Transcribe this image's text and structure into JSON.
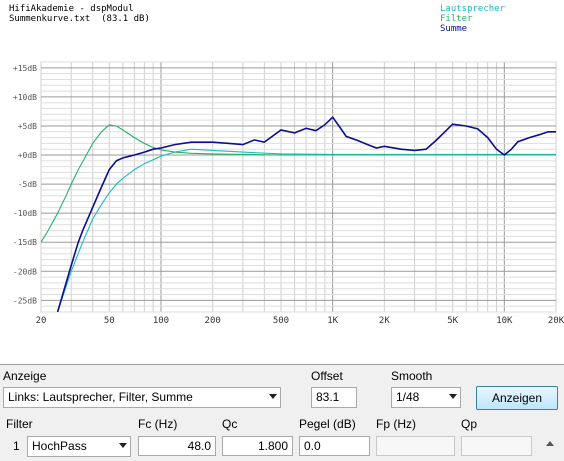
{
  "plot": {
    "header_line1": "HifiAkademie - dspModul",
    "header_line2": "Summenkurve.txt  (83.1 dB)",
    "legend": [
      {
        "label": "Lautsprecher",
        "color": "#19bcc1"
      },
      {
        "label": "Filter",
        "color": "#21b36a"
      },
      {
        "label": "Summe",
        "color": "#0b0f8f"
      }
    ],
    "y_ticks": [
      "+15dB",
      "+10dB",
      "+5dB",
      "+0dB",
      "-5dB",
      "-10dB",
      "-15dB",
      "-20dB",
      "-25dB"
    ],
    "x_ticks": [
      "20",
      "50",
      "100",
      "200",
      "500",
      "1K",
      "2K",
      "5K",
      "10K",
      "20K"
    ]
  },
  "chart_data": {
    "type": "line",
    "title": "Summenkurve.txt  (83.1 dB)",
    "x_scale": "log",
    "xlim": [
      20,
      20000
    ],
    "ylim": [
      -27,
      16
    ],
    "grid": true,
    "legend_position": "top-right",
    "series": [
      {
        "name": "Lautsprecher",
        "color": "#19bcc1",
        "x": [
          25,
          30,
          35,
          40,
          45,
          50,
          55,
          60,
          70,
          80,
          100,
          120,
          150,
          200,
          300,
          500,
          1000,
          2000,
          5000,
          10000,
          20000
        ],
        "y": [
          -27,
          -20,
          -15,
          -11,
          -8.5,
          -6.5,
          -5,
          -4,
          -2.5,
          -1.5,
          -0.2,
          0.5,
          1,
          0.8,
          0.5,
          0.2,
          0.1,
          0.1,
          0.1,
          0.1,
          0.1
        ]
      },
      {
        "name": "Filter",
        "color": "#21b36a",
        "x": [
          20,
          22,
          25,
          28,
          30,
          33,
          36,
          40,
          45,
          50,
          55,
          60,
          70,
          80,
          90,
          100,
          120,
          150,
          200,
          300,
          500,
          1000,
          2000,
          5000,
          10000,
          20000
        ],
        "y": [
          -15,
          -13,
          -10,
          -7,
          -5,
          -2.5,
          -0.5,
          2,
          4,
          5.2,
          5,
          4.3,
          3,
          2,
          1.3,
          0.9,
          0.5,
          0.3,
          0.2,
          0.1,
          0,
          0,
          0,
          0,
          0,
          0
        ]
      },
      {
        "name": "Summe",
        "color": "#0b0f8f",
        "x": [
          25,
          28,
          30,
          33,
          35,
          40,
          45,
          50,
          55,
          60,
          70,
          80,
          90,
          100,
          120,
          150,
          200,
          250,
          300,
          350,
          400,
          500,
          600,
          700,
          800,
          900,
          1000,
          1100,
          1200,
          1400,
          1600,
          1800,
          2000,
          2500,
          3000,
          3500,
          4000,
          5000,
          6000,
          7000,
          8000,
          9000,
          10000,
          11000,
          12000,
          14000,
          16000,
          18000,
          20000
        ],
        "y": [
          -27,
          -22,
          -19,
          -15,
          -13,
          -9,
          -5.5,
          -2.5,
          -1,
          -0.5,
          0,
          0.5,
          1,
          1.2,
          1.8,
          2.2,
          2.2,
          2,
          1.8,
          2.6,
          2.2,
          4.3,
          3.8,
          4.6,
          4.2,
          5.2,
          6.5,
          4.8,
          3.2,
          2.5,
          1.8,
          1.2,
          1.5,
          1,
          0.8,
          1,
          2.5,
          5.3,
          5,
          4.5,
          3,
          1,
          0,
          1,
          2.3,
          3,
          3.5,
          4,
          4
        ]
      }
    ]
  },
  "controls": {
    "anzeige_label": "Anzeige",
    "anzeige_value": "Links: Lautsprecher, Filter, Summe",
    "offset_label": "Offset",
    "offset_value": "83.1",
    "smooth_label": "Smooth",
    "smooth_value": "1/48",
    "anzeigen_button": "Anzeigen",
    "filter_label": "Filter",
    "fc_label": "Fc (Hz)",
    "qc_label": "Qc",
    "pegel_label": "Pegel (dB)",
    "fp_label": "Fp (Hz)",
    "qp_label": "Qp",
    "row_number": "1",
    "filter_type": "HochPass",
    "fc_value": "48.0",
    "qc_value": "1.800",
    "pegel_value": "0.0",
    "fp_value": "",
    "qp_value": ""
  }
}
